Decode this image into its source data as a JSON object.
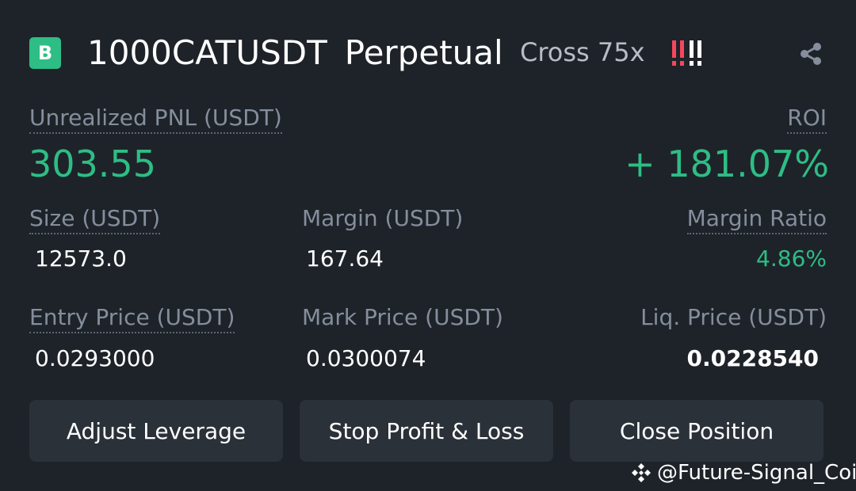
{
  "header": {
    "badge": "B",
    "symbol": "1000CATUSDT",
    "contract_type": "Perpetual",
    "margin_mode": "Cross 75x",
    "risk_icon": "risk-warning-icon",
    "share_icon": "share-icon"
  },
  "pnl": {
    "label": "Unrealized PNL (USDT)",
    "value": "303.55",
    "roi_label": "ROI",
    "roi_value": "+ 181.07%"
  },
  "stats": {
    "size_label": "Size (USDT)",
    "size_value": "12573.0",
    "margin_label": "Margin (USDT)",
    "margin_value": "167.64",
    "margin_ratio_label": "Margin Ratio",
    "margin_ratio_value": "4.86%",
    "entry_label": "Entry Price (USDT)",
    "entry_value": "0.0293000",
    "mark_label": "Mark Price (USDT)",
    "mark_value": "0.0300074",
    "liq_label": "Liq. Price (USDT)",
    "liq_value": "0.0228540"
  },
  "actions": {
    "adjust_leverage": "Adjust Leverage",
    "stop_profit_loss": "Stop Profit & Loss",
    "close_position": "Close Position"
  },
  "watermark": {
    "text": "@Future-Signal_Coin",
    "icon": "binance-logo-icon"
  },
  "colors": {
    "background": "#1e2329",
    "profit_green": "#2ebd85",
    "badge_green": "#2ebd85",
    "button_bg": "#2b3139",
    "label_gray": "#848e9c",
    "risk_red": "#f6465d"
  }
}
